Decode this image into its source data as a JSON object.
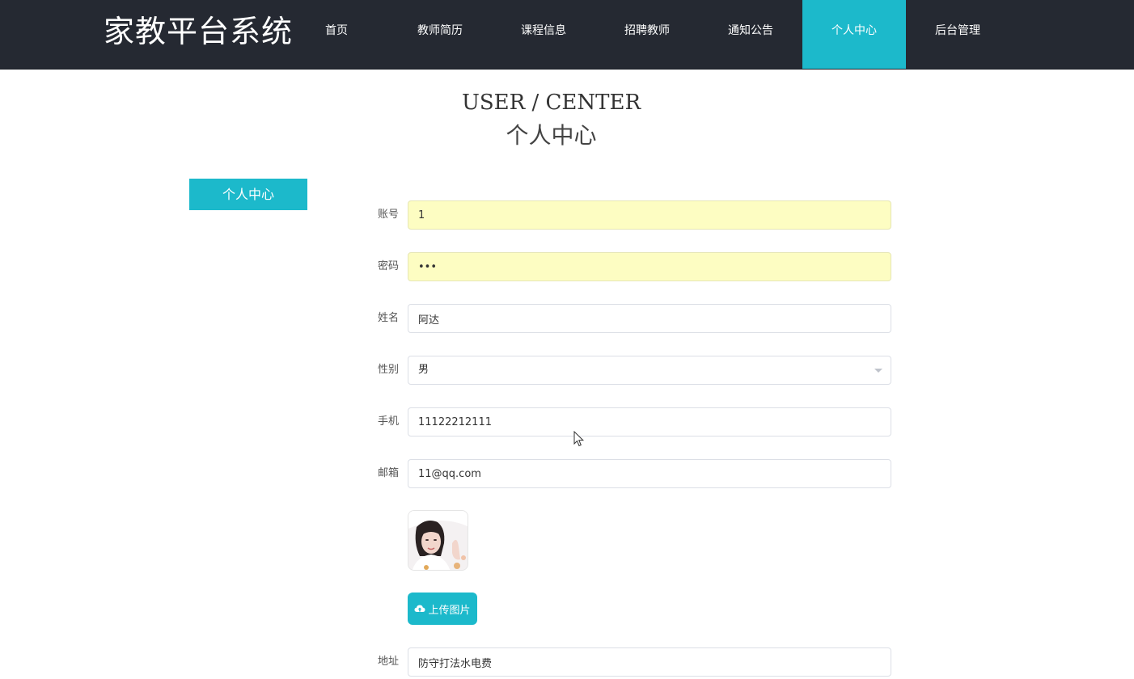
{
  "brand": "家教平台系统",
  "nav": [
    {
      "label": "首页",
      "active": false
    },
    {
      "label": "教师简历",
      "active": false
    },
    {
      "label": "课程信息",
      "active": false
    },
    {
      "label": "招聘教师",
      "active": false
    },
    {
      "label": "通知公告",
      "active": false
    },
    {
      "label": "个人中心",
      "active": true
    },
    {
      "label": "后台管理",
      "active": false
    }
  ],
  "page_title": {
    "en": "USER / CENTER",
    "cn": "个人中心"
  },
  "sidebar": {
    "items": [
      {
        "label": "个人中心"
      }
    ]
  },
  "form": {
    "account": {
      "label": "账号",
      "value": "1"
    },
    "password": {
      "label": "密码",
      "value": "123"
    },
    "name": {
      "label": "姓名",
      "value": "阿达"
    },
    "gender": {
      "label": "性别",
      "value": "男"
    },
    "phone": {
      "label": "手机",
      "value": "11122212111"
    },
    "email": {
      "label": "邮箱",
      "value": "11@qq.com"
    },
    "upload_label": "上传图片",
    "address": {
      "label": "地址",
      "value": "防守打法水电费"
    }
  },
  "colors": {
    "topbar": "#252932",
    "accent": "#1cb9cb",
    "autofill": "#fdfdc2"
  }
}
